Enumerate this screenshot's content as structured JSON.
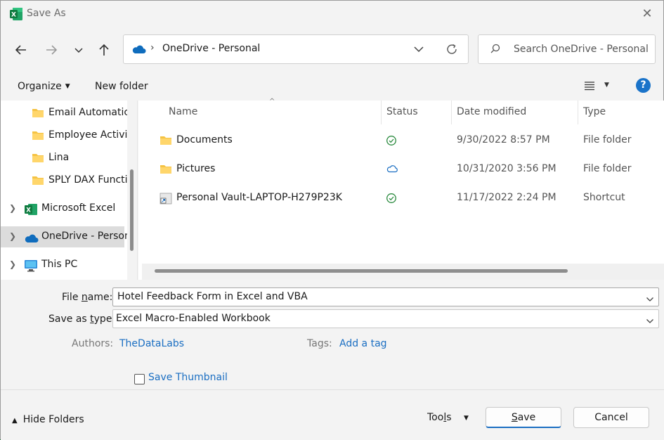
{
  "window": {
    "title": "Save As",
    "close_glyph": "✕"
  },
  "nav": {
    "address_path": "OneDrive - Personal",
    "address_sep": "›",
    "search_placeholder": "Search OneDrive - Personal"
  },
  "toolbar": {
    "organize_label": "Organize",
    "new_folder_label": "New folder",
    "help_glyph": "?"
  },
  "sidebar": {
    "items": [
      {
        "label": "Email Automatic",
        "icon": "folder-icon"
      },
      {
        "label": "Employee Activi",
        "icon": "folder-icon"
      },
      {
        "label": "Lina",
        "icon": "folder-icon"
      },
      {
        "label": "SPLY DAX Functi",
        "icon": "folder-icon"
      },
      {
        "label": "Microsoft Excel",
        "icon": "excel-icon"
      },
      {
        "label": "OneDrive - Person",
        "icon": "onedrive-icon",
        "selected": true
      },
      {
        "label": "This PC",
        "icon": "computer-icon"
      }
    ]
  },
  "columns": {
    "name": "Name",
    "status": "Status",
    "date_modified": "Date modified",
    "type": "Type"
  },
  "files": [
    {
      "name": "Documents",
      "status": "available-offline",
      "date": "9/30/2022 8:57 PM",
      "type": "File folder"
    },
    {
      "name": "Pictures",
      "status": "cloud-only",
      "date": "10/31/2020 3:56 PM",
      "type": "File folder"
    },
    {
      "name": "Personal Vault-LAPTOP-H279P23K",
      "status": "available-offline",
      "date": "11/17/2022 2:24 PM",
      "type": "Shortcut"
    }
  ],
  "form": {
    "file_name_label_pre": "File ",
    "file_name_label_u": "n",
    "file_name_label_post": "ame:",
    "file_name_value": "Hotel Feedback Form in Excel and VBA",
    "save_type_label_pre": "Save as ",
    "save_type_label_u": "t",
    "save_type_label_post": "ype:",
    "save_type_value": "Excel Macro-Enabled Workbook",
    "authors_label": "Authors:",
    "authors_value": "TheDataLabs",
    "tags_label": "Tags:",
    "tags_value": "Add a tag",
    "save_thumbnail_label": "Save Thumbnail"
  },
  "footer": {
    "hide_folders_label": "Hide Folders",
    "tools_pre": "Too",
    "tools_u": "l",
    "tools_post": "s",
    "save_pre": "",
    "save_u": "S",
    "save_post": "ave",
    "cancel_label": "Cancel"
  },
  "colors": {
    "accent": "#1a73c9",
    "link": "#1a6ec2",
    "folder": "#f5c343",
    "status_ok": "#2a8a3e",
    "excel": "#1e7145"
  }
}
